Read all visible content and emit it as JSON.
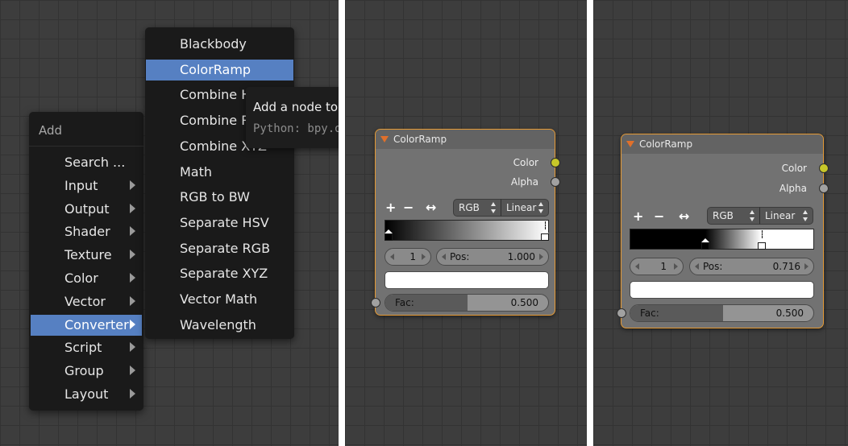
{
  "add_menu": {
    "title": "Add",
    "items": [
      {
        "label": "Search ...",
        "submenu": false,
        "active": false
      },
      {
        "label": "Input",
        "submenu": true,
        "active": false
      },
      {
        "label": "Output",
        "submenu": true,
        "active": false
      },
      {
        "label": "Shader",
        "submenu": true,
        "active": false
      },
      {
        "label": "Texture",
        "submenu": true,
        "active": false
      },
      {
        "label": "Color",
        "submenu": true,
        "active": false
      },
      {
        "label": "Vector",
        "submenu": true,
        "active": false
      },
      {
        "label": "Converter",
        "submenu": true,
        "active": true
      },
      {
        "label": "Script",
        "submenu": true,
        "active": false
      },
      {
        "label": "Group",
        "submenu": true,
        "active": false
      },
      {
        "label": "Layout",
        "submenu": true,
        "active": false
      }
    ]
  },
  "converter_menu": {
    "items": [
      {
        "label": "Blackbody",
        "active": false
      },
      {
        "label": "ColorRamp",
        "active": true
      },
      {
        "label": "Combine HSV",
        "active": false
      },
      {
        "label": "Combine RGB",
        "active": false
      },
      {
        "label": "Combine XYZ",
        "active": false
      },
      {
        "label": "Math",
        "active": false
      },
      {
        "label": "RGB to BW",
        "active": false
      },
      {
        "label": "Separate HSV",
        "active": false
      },
      {
        "label": "Separate RGB",
        "active": false
      },
      {
        "label": "Separate XYZ",
        "active": false
      },
      {
        "label": "Vector Math",
        "active": false
      },
      {
        "label": "Wavelength",
        "active": false
      }
    ]
  },
  "tooltip": {
    "line1": "Add a node to t",
    "line2": "Python: bpy.o"
  },
  "nodes": [
    {
      "title": "ColorRamp",
      "outputs": {
        "color": "Color",
        "alpha": "Alpha"
      },
      "tools": {
        "add": "+",
        "remove": "−",
        "flip": "↔"
      },
      "color_mode": "RGB",
      "interpolation": "Linear",
      "stops": [
        0.0,
        1.0
      ],
      "active_stop_pos": 1.0,
      "index": "1",
      "pos_label": "Pos:",
      "pos_value": "1.000",
      "fac_label": "Fac:",
      "fac_value": "0.500",
      "fac_fraction": 0.5
    },
    {
      "title": "ColorRamp",
      "outputs": {
        "color": "Color",
        "alpha": "Alpha"
      },
      "tools": {
        "add": "+",
        "remove": "−",
        "flip": "↔"
      },
      "color_mode": "RGB",
      "interpolation": "Linear",
      "stops": [
        0.41,
        0.716
      ],
      "active_stop_pos": 0.716,
      "index": "1",
      "pos_label": "Pos:",
      "pos_value": "0.716",
      "fac_label": "Fac:",
      "fac_value": "0.500",
      "fac_fraction": 0.5
    }
  ],
  "colors": {
    "menu_highlight": "#5680c2",
    "node_border": "#e59a35",
    "color_socket": "#c7c729",
    "alpha_socket": "#a1a1a1"
  }
}
